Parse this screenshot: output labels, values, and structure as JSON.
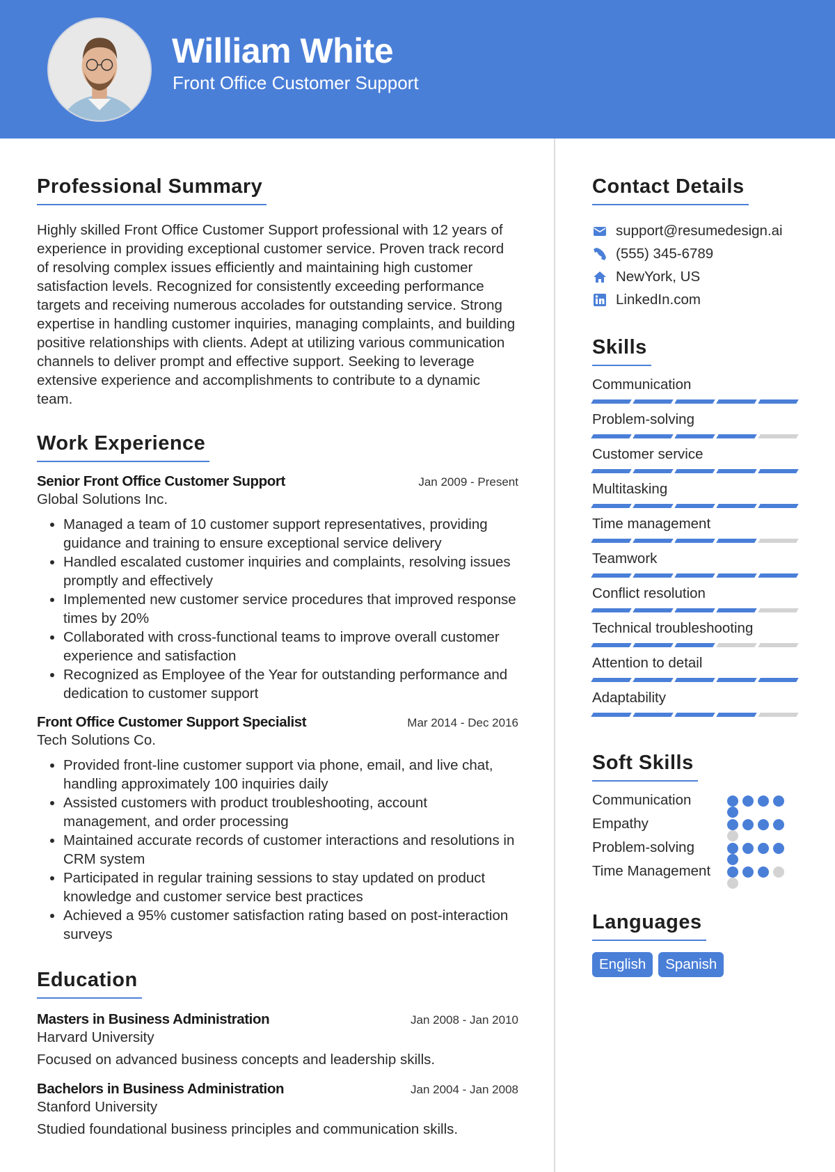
{
  "header": {
    "name": "William White",
    "title": "Front Office Customer Support",
    "accent_color": "#4a7fd8"
  },
  "summary": {
    "heading": "Professional Summary",
    "text": "Highly skilled Front Office Customer Support professional with 12 years of experience in providing exceptional customer service. Proven track record of resolving complex issues efficiently and maintaining high customer satisfaction levels. Recognized for consistently exceeding performance targets and receiving numerous accolades for outstanding service. Strong expertise in handling customer inquiries, managing complaints, and building positive relationships with clients. Adept at utilizing various communication channels to deliver prompt and effective support. Seeking to leverage extensive experience and accomplishments to contribute to a dynamic team."
  },
  "experience": {
    "heading": "Work Experience",
    "jobs": [
      {
        "title": "Senior Front Office Customer Support",
        "date": "Jan 2009 - Present",
        "company": "Global Solutions Inc.",
        "bullets": [
          "Managed a team of 10 customer support representatives, providing guidance and training to ensure exceptional service delivery",
          "Handled escalated customer inquiries and complaints, resolving issues promptly and effectively",
          "Implemented new customer service procedures that improved response times by 20%",
          "Collaborated with cross-functional teams to improve overall customer experience and satisfaction",
          "Recognized as Employee of the Year for outstanding performance and dedication to customer support"
        ]
      },
      {
        "title": "Front Office Customer Support Specialist",
        "date": "Mar 2014 - Dec 2016",
        "company": "Tech Solutions Co.",
        "bullets": [
          "Provided front-line customer support via phone, email, and live chat, handling approximately 100 inquiries daily",
          "Assisted customers with product troubleshooting, account management, and order processing",
          "Maintained accurate records of customer interactions and resolutions in CRM system",
          "Participated in regular training sessions to stay updated on product knowledge and customer service best practices",
          "Achieved a 95% customer satisfaction rating based on post-interaction surveys"
        ]
      }
    ]
  },
  "education": {
    "heading": "Education",
    "items": [
      {
        "degree": "Masters in Business Administration",
        "date": "Jan 2008 - Jan 2010",
        "school": "Harvard University",
        "desc": "Focused on advanced business concepts and leadership skills."
      },
      {
        "degree": "Bachelors in Business Administration",
        "date": "Jan 2004 - Jan 2008",
        "school": "Stanford University",
        "desc": "Studied foundational business principles and communication skills."
      }
    ]
  },
  "contact": {
    "heading": "Contact Details",
    "items": [
      {
        "icon": "envelope-icon",
        "text": "support@resumedesign.ai"
      },
      {
        "icon": "phone-icon",
        "text": "(555) 345-6789"
      },
      {
        "icon": "home-icon",
        "text": "NewYork, US"
      },
      {
        "icon": "linkedin-icon",
        "text": "LinkedIn.com"
      }
    ]
  },
  "skills": {
    "heading": "Skills",
    "max": 5,
    "items": [
      {
        "name": "Communication",
        "level": 5
      },
      {
        "name": "Problem-solving",
        "level": 4
      },
      {
        "name": "Customer service",
        "level": 5
      },
      {
        "name": "Multitasking",
        "level": 5
      },
      {
        "name": "Time management",
        "level": 4
      },
      {
        "name": "Teamwork",
        "level": 5
      },
      {
        "name": "Conflict resolution",
        "level": 4
      },
      {
        "name": "Technical troubleshooting",
        "level": 3
      },
      {
        "name": "Attention to detail",
        "level": 5
      },
      {
        "name": "Adaptability",
        "level": 4
      }
    ]
  },
  "soft_skills": {
    "heading": "Soft Skills",
    "max": 5,
    "items": [
      {
        "name": "Communication",
        "level": 5
      },
      {
        "name": "Empathy",
        "level": 4
      },
      {
        "name": "Problem-solving",
        "level": 5
      },
      {
        "name": "Time Management",
        "level": 3
      }
    ]
  },
  "languages": {
    "heading": "Languages",
    "items": [
      "English",
      "Spanish"
    ]
  }
}
